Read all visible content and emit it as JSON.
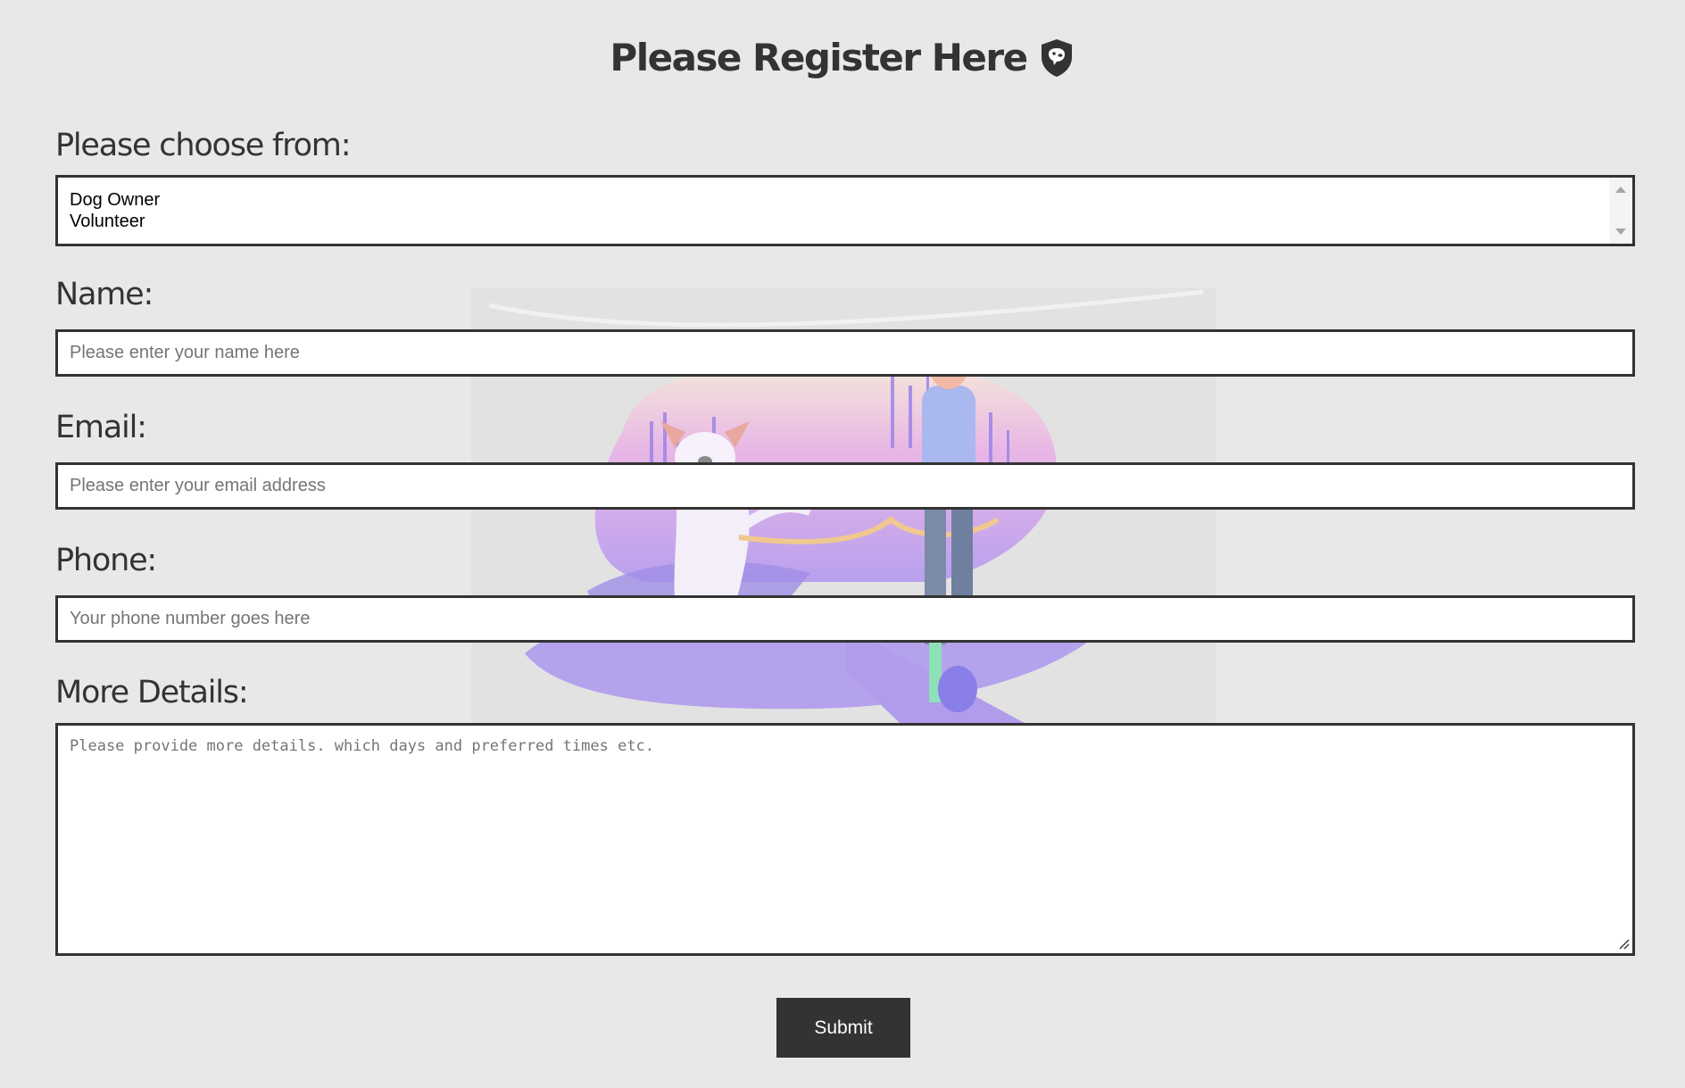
{
  "header": {
    "title": "Please Register Here",
    "title_icon": "shield-dog-icon"
  },
  "form": {
    "role": {
      "label": "Please choose from:",
      "options": [
        "Dog Owner",
        "Volunteer"
      ]
    },
    "name": {
      "label": "Name:",
      "value": "",
      "placeholder": "Please enter your name here"
    },
    "email": {
      "label": "Email:",
      "value": "",
      "placeholder": "Please enter your email address"
    },
    "phone": {
      "label": "Phone:",
      "value": "",
      "placeholder": "Your phone number goes here"
    },
    "details": {
      "label": "More Details:",
      "value": "",
      "placeholder": "Please provide more details. which days and preferred times etc."
    },
    "submit_label": "Submit"
  },
  "background": {
    "image": "dog-walker-illustration"
  },
  "colors": {
    "page_background": "#e8e8e8",
    "text": "#333333",
    "input_border": "#333333",
    "button_background": "#333333",
    "button_text": "#ffffff",
    "illustration_accent": "#b9a6ee"
  }
}
